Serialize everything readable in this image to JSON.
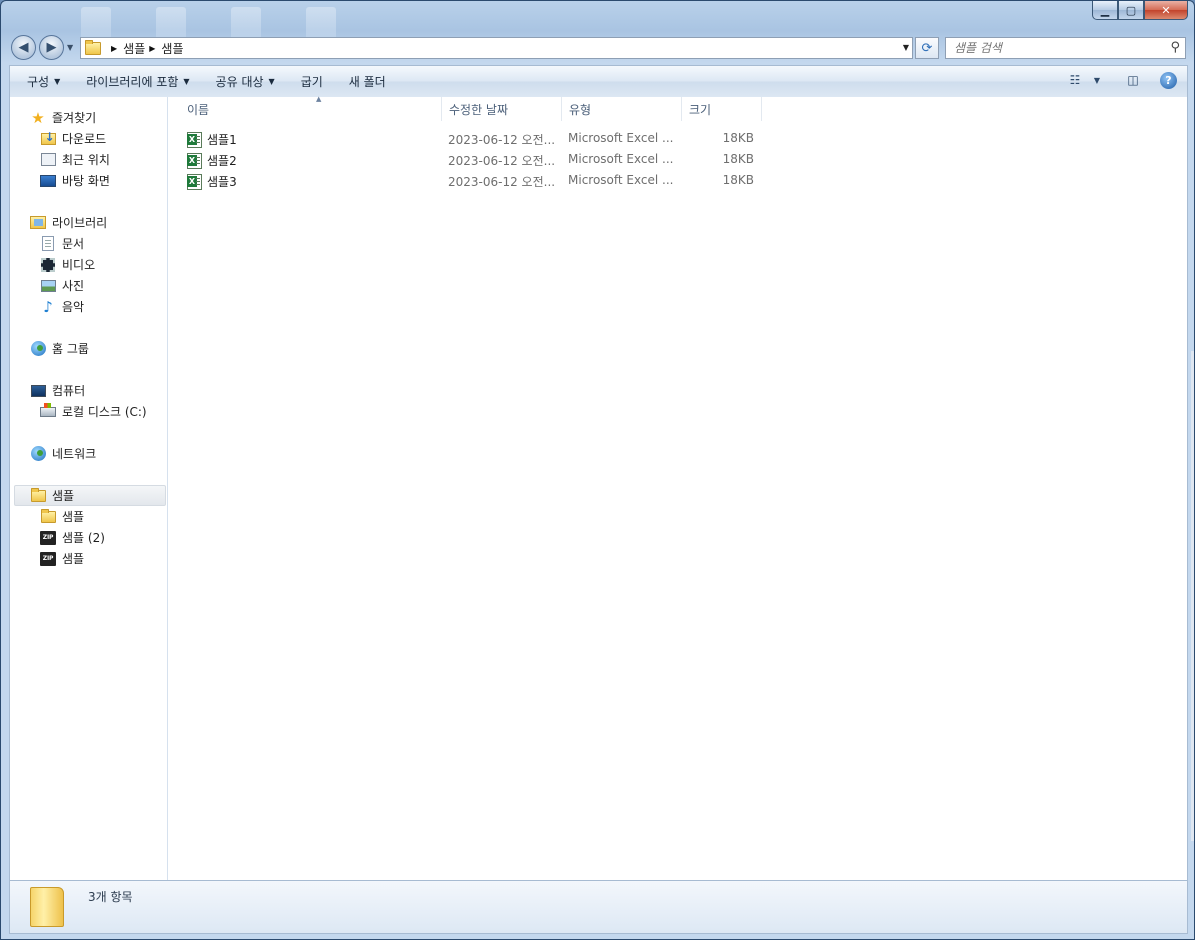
{
  "address": {
    "crumbs": [
      "샘플",
      "샘플"
    ]
  },
  "search": {
    "placeholder": "샘플 검색"
  },
  "toolbar": {
    "organize": "구성",
    "include_library": "라이브러리에 포함",
    "share_with": "공유 대상",
    "burn": "굽기",
    "new_folder": "새 폴더"
  },
  "nav": {
    "favorites": {
      "label": "즐겨찾기",
      "items": [
        "다운로드",
        "최근 위치",
        "바탕 화면"
      ]
    },
    "libraries": {
      "label": "라이브러리",
      "items": [
        "문서",
        "비디오",
        "사진",
        "음악"
      ]
    },
    "homegroup": "홈 그룹",
    "computer": {
      "label": "컴퓨터",
      "items": [
        "로컬 디스크 (C:)"
      ]
    },
    "network": "네트워크",
    "current": {
      "label": "샘플",
      "items": [
        "샘플",
        "샘플 (2)",
        "샘플"
      ]
    }
  },
  "columns": {
    "name": "이름",
    "date": "수정한 날짜",
    "type": "유형",
    "size": "크기"
  },
  "files": [
    {
      "name": "샘플1",
      "date": "2023-06-12 오전...",
      "type": "Microsoft Excel ...",
      "size": "18KB"
    },
    {
      "name": "샘플2",
      "date": "2023-06-12 오전...",
      "type": "Microsoft Excel ...",
      "size": "18KB"
    },
    {
      "name": "샘플3",
      "date": "2023-06-12 오전...",
      "type": "Microsoft Excel ...",
      "size": "18KB"
    }
  ],
  "details": {
    "count_text": "3개 항목"
  },
  "icons": {
    "back": "back-arrow-icon",
    "forward": "forward-arrow-icon",
    "refresh": "refresh-icon",
    "search": "search-icon",
    "views": "view-options-icon",
    "preview": "preview-pane-icon",
    "help": "help-icon"
  }
}
